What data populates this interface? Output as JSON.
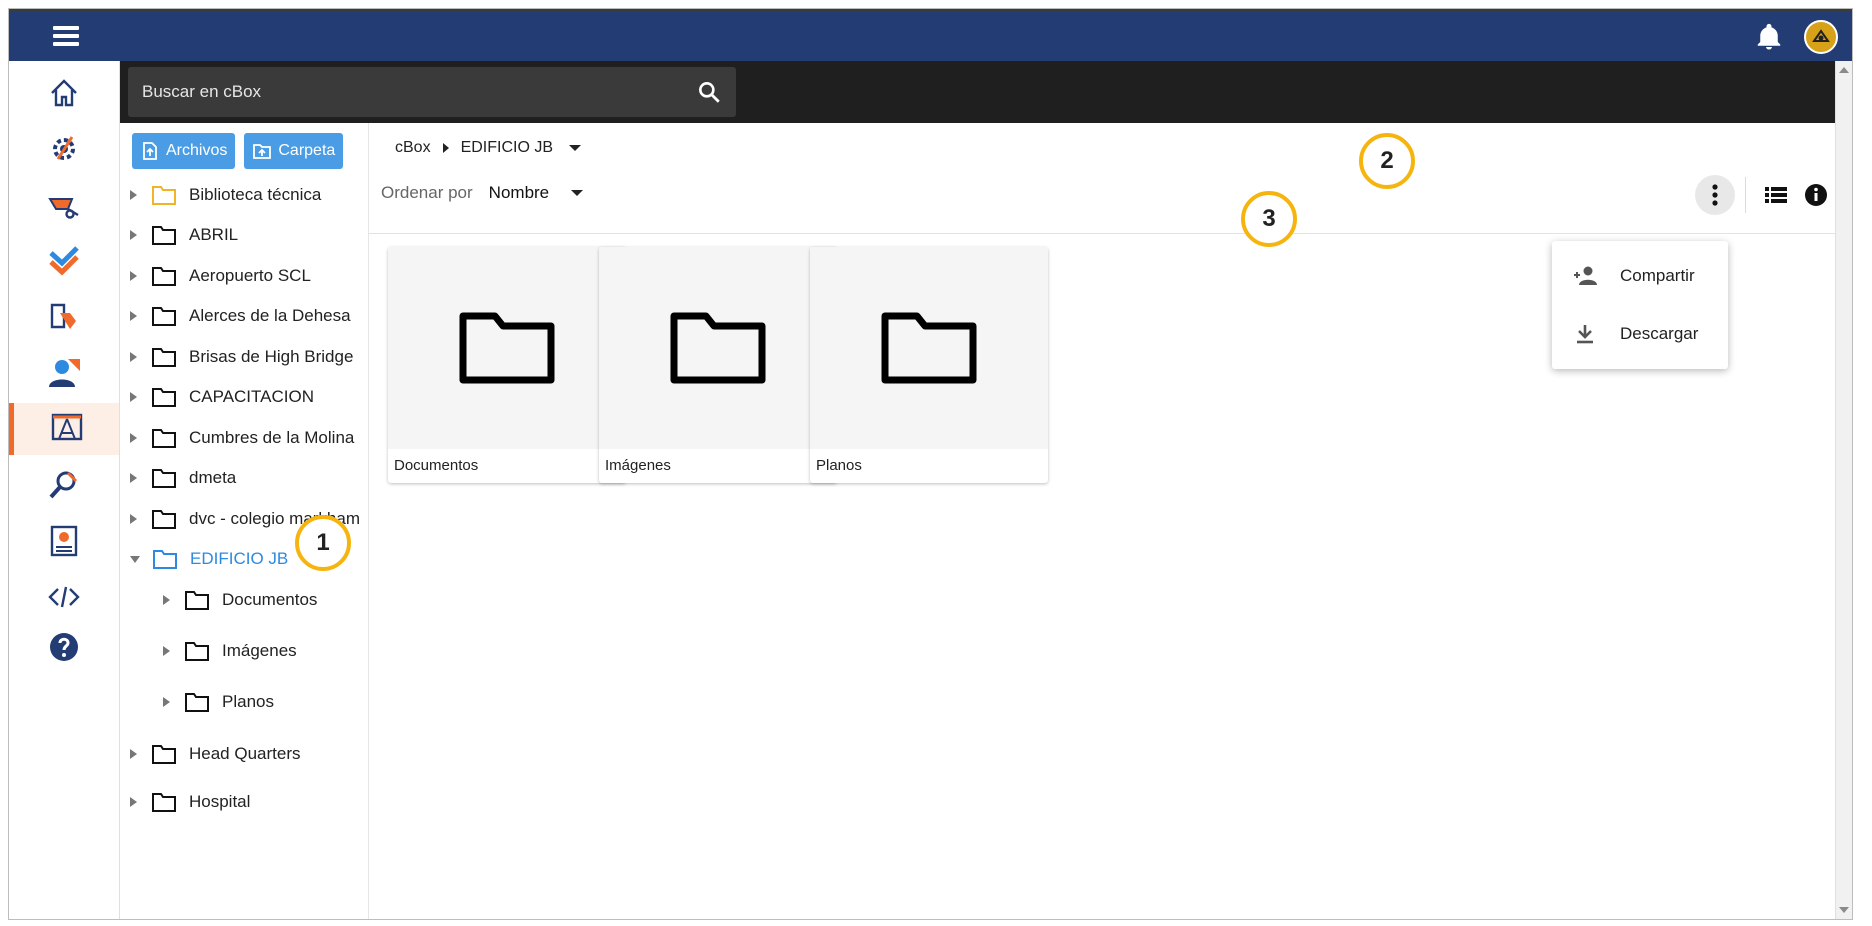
{
  "search": {
    "placeholder": "Buscar en cBox"
  },
  "tree": {
    "buttons": {
      "upload_files": "Archivos",
      "upload_folder": "Carpeta"
    },
    "items": [
      {
        "label": "Biblioteca técnica"
      },
      {
        "label": "ABRIL"
      },
      {
        "label": "Aeropuerto SCL"
      },
      {
        "label": "Alerces de la Dehesa"
      },
      {
        "label": "Brisas de High Bridge"
      },
      {
        "label": "CAPACITACION"
      },
      {
        "label": "Cumbres de la Molina"
      },
      {
        "label": "dmeta"
      },
      {
        "label": "dvc - colegio markham"
      },
      {
        "label": "EDIFICIO JB"
      },
      {
        "label": "Documentos"
      },
      {
        "label": "Imágenes"
      },
      {
        "label": "Planos"
      },
      {
        "label": "Head Quarters"
      },
      {
        "label": "Hospital"
      }
    ]
  },
  "breadcrumb": {
    "root": "cBox",
    "current": "EDIFICIO JB"
  },
  "sort": {
    "label": "Ordenar por",
    "value": "Nombre"
  },
  "cards": [
    {
      "name": "Documentos"
    },
    {
      "name": "Imágenes"
    },
    {
      "name": "Planos"
    }
  ],
  "menu": {
    "share": "Compartir",
    "download": "Descargar"
  },
  "markers": {
    "m1": "1",
    "m2": "2",
    "m3": "3"
  },
  "colors": {
    "topbar": "#243c74",
    "accent_blue": "#2d8ae0",
    "marker": "#f6b40e",
    "rail_active": "#ef6a2b"
  }
}
